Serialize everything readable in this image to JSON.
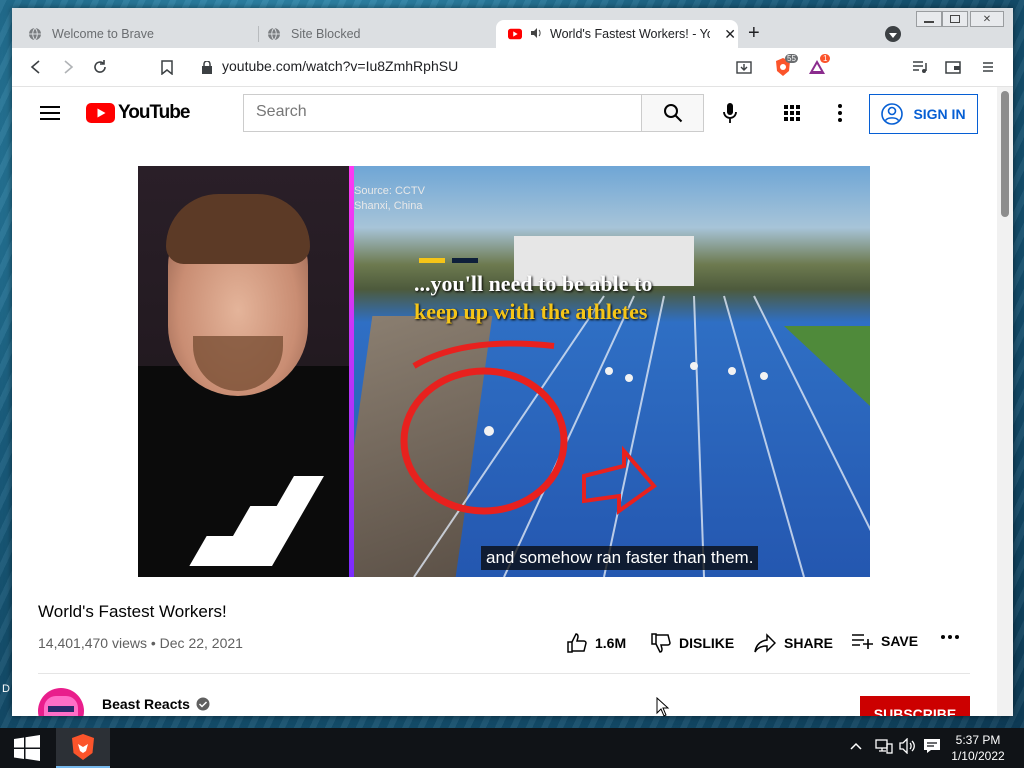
{
  "browser": {
    "tabs": [
      {
        "label": "Welcome to Brave",
        "icon": "globe-icon"
      },
      {
        "label": "Site Blocked",
        "icon": "globe-icon"
      },
      {
        "label": "World's Fastest Workers! - You",
        "icon": "youtube-icon",
        "active": true
      }
    ],
    "url": "youtube.com/watch?v=Iu8ZmhRphSU",
    "shields_count": "55",
    "rewards_count": "1"
  },
  "youtube": {
    "logo_text": "YouTube",
    "search_placeholder": "Search",
    "signin_label": "SIGN IN"
  },
  "video": {
    "caption": "and somehow ran faster than them.",
    "overlay_line1": "...you'll need to be able to",
    "overlay_line2": "keep up with the athletes",
    "source_line1": "Source: CCTV",
    "source_line2": "Shanxi, China",
    "title": "World's Fastest Workers!",
    "views": "14,401,470 views",
    "date": "Dec 22, 2021",
    "separator": "•"
  },
  "actions": {
    "like_count": "1.6M",
    "dislike_label": "DISLIKE",
    "share_label": "SHARE",
    "save_label": "SAVE"
  },
  "channel": {
    "name": "Beast Reacts",
    "subscribe_label": "SUBSCRIBE"
  },
  "taskbar": {
    "time": "5:37 PM",
    "date": "1/10/2022"
  },
  "desktop": {
    "edge_letter": "D"
  },
  "colors": {
    "youtube_red": "#ff0000",
    "signin_blue": "#065fd4",
    "subscribe_red": "#cc0000"
  }
}
